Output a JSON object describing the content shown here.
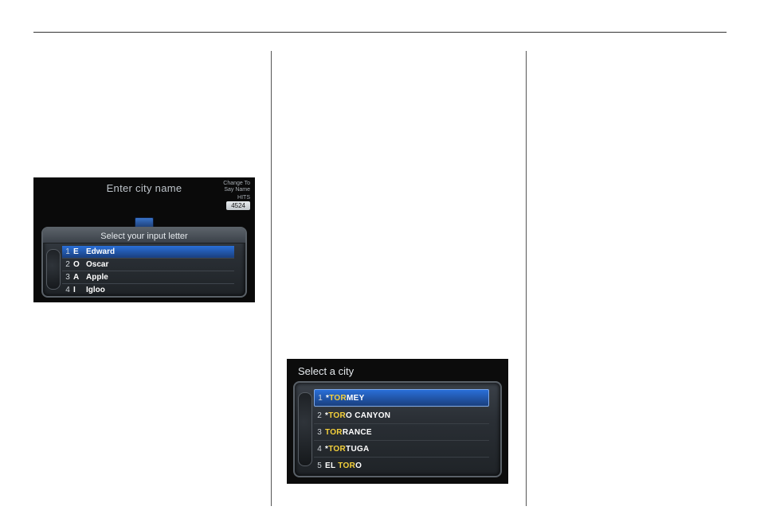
{
  "screen1": {
    "title": "Enter city name",
    "change_to": "Change To",
    "say_name": "Say Name",
    "hits_label": "HITS",
    "hits_value": "4524",
    "panel_title": "Select your input letter",
    "rows": [
      {
        "num": "1",
        "letter": "E",
        "word": "Edward"
      },
      {
        "num": "2",
        "letter": "O",
        "word": "Oscar"
      },
      {
        "num": "3",
        "letter": "A",
        "word": "Apple"
      },
      {
        "num": "4",
        "letter": "I",
        "word": "Igloo"
      }
    ]
  },
  "screen2": {
    "title": "Select a city",
    "rows": [
      {
        "num": "1",
        "pre": "*",
        "match": "TOR",
        "rest": "MEY"
      },
      {
        "num": "2",
        "pre": "*",
        "match": "TOR",
        "rest": "O CANYON"
      },
      {
        "num": "3",
        "pre": "",
        "match": "TOR",
        "rest": "RANCE"
      },
      {
        "num": "4",
        "pre": "*",
        "match": "TOR",
        "rest": "TUGA"
      },
      {
        "num": "5",
        "pre": "EL ",
        "match": "TOR",
        "rest": "O"
      }
    ]
  }
}
